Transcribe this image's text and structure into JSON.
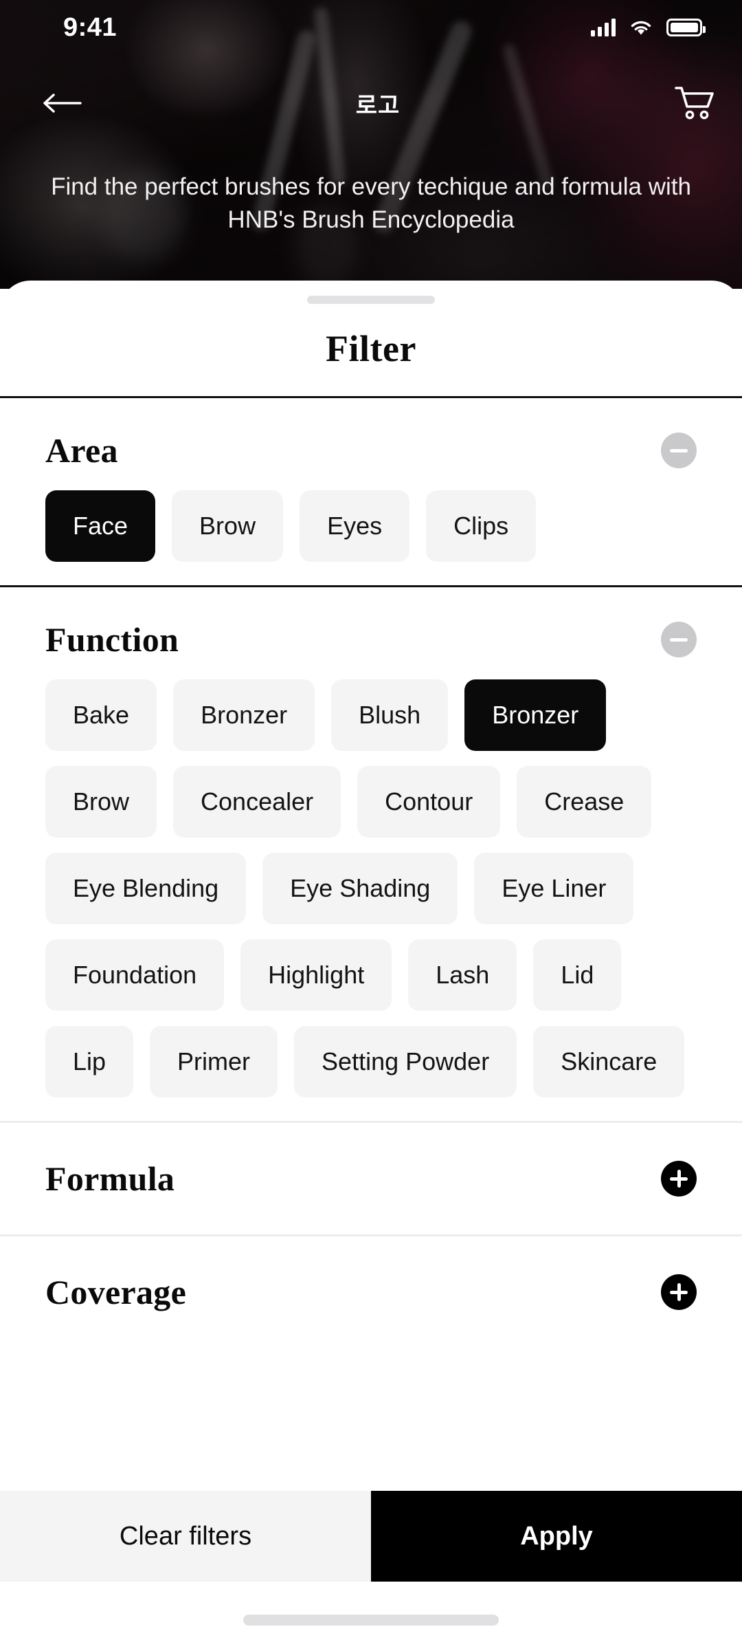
{
  "status_bar": {
    "time": "9:41",
    "signal_icon": "cellular-signal-icon",
    "wifi_icon": "wifi-icon",
    "battery_icon": "battery-full-icon"
  },
  "hero": {
    "back_icon": "arrow-left-icon",
    "logo": "로고",
    "cart_icon": "shopping-cart-icon",
    "tagline": "Find the perfect brushes for every techique and formula with HNB's Brush Encyclopedia"
  },
  "sheet": {
    "title": "Filter",
    "grabber": "drag-handle"
  },
  "sections": [
    {
      "title": "Area",
      "expanded": true,
      "toggle_icon": "minus-circle-icon",
      "chips": [
        {
          "label": "Face",
          "selected": true
        },
        {
          "label": "Brow",
          "selected": false
        },
        {
          "label": "Eyes",
          "selected": false
        },
        {
          "label": "Clips",
          "selected": false
        }
      ]
    },
    {
      "title": "Function",
      "expanded": true,
      "toggle_icon": "minus-circle-icon",
      "chips": [
        {
          "label": "Bake",
          "selected": false
        },
        {
          "label": "Bronzer",
          "selected": false
        },
        {
          "label": "Blush",
          "selected": false
        },
        {
          "label": "Bronzer",
          "selected": true
        },
        {
          "label": "Brow",
          "selected": false
        },
        {
          "label": "Concealer",
          "selected": false
        },
        {
          "label": "Contour",
          "selected": false
        },
        {
          "label": "Crease",
          "selected": false
        },
        {
          "label": "Eye Blending",
          "selected": false
        },
        {
          "label": "Eye Shading",
          "selected": false
        },
        {
          "label": "Eye Liner",
          "selected": false
        },
        {
          "label": "Foundation",
          "selected": false
        },
        {
          "label": "Highlight",
          "selected": false
        },
        {
          "label": "Lash",
          "selected": false
        },
        {
          "label": "Lid",
          "selected": false
        },
        {
          "label": "Lip",
          "selected": false
        },
        {
          "label": "Primer",
          "selected": false
        },
        {
          "label": "Setting Powder",
          "selected": false
        },
        {
          "label": "Skincare",
          "selected": false
        }
      ]
    },
    {
      "title": "Formula",
      "expanded": false,
      "toggle_icon": "plus-circle-icon",
      "chips": []
    },
    {
      "title": "Coverage",
      "expanded": false,
      "toggle_icon": "plus-circle-icon",
      "chips": []
    }
  ],
  "action_bar": {
    "clear_label": "Clear filters",
    "apply_label": "Apply"
  },
  "colors": {
    "accent": "#000000",
    "chip_bg": "#f4f4f5",
    "chip_selected_bg": "#0a0a0a",
    "toggle_minus_bg": "#c9c9cc"
  }
}
